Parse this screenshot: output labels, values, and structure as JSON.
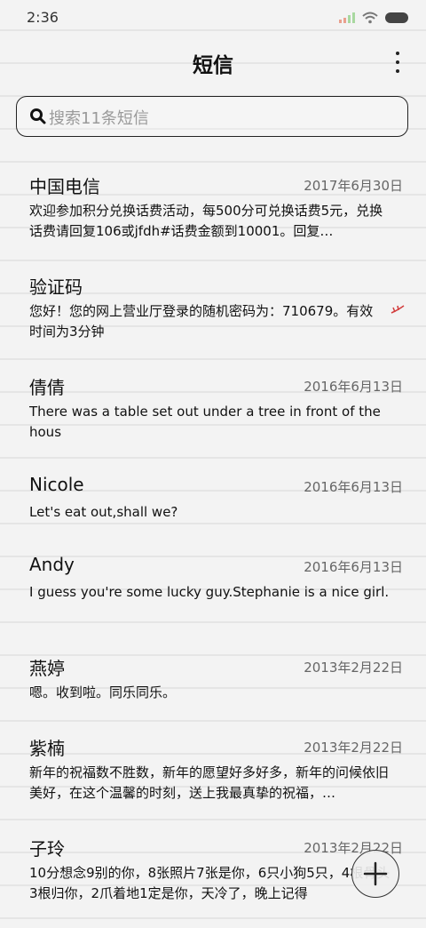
{
  "status_bar": {
    "time": "2:36",
    "signal_icon": "signal-icon",
    "wifi_icon": "wifi-icon",
    "battery_icon": "battery-icon"
  },
  "header": {
    "title": "短信",
    "more_icon": "more-vertical-icon"
  },
  "search": {
    "placeholder": "搜索11条短信",
    "icon": "search-icon"
  },
  "messages": [
    {
      "sender": "中国电信",
      "date": "2017年6月30日",
      "snippet": "欢迎参加积分兑换话费活动，每500分可兑换话费5元，兑换话费请回复106或jfdh#话费金额到10001。回复…"
    },
    {
      "sender": "验证码",
      "date": "",
      "snippet": "您好！您的网上营业厅登录的随机密码为：710679。有效时间为3分钟",
      "flag_icon": "red-flag-icon"
    },
    {
      "sender": "倩倩",
      "date": "2016年6月13日",
      "snippet": "There was a table set out under a tree in front of the hous"
    },
    {
      "sender": "Nicole",
      "date": "2016年6月13日",
      "snippet": "Let's eat out,shall we?"
    },
    {
      "sender": "Andy",
      "date": "2016年6月13日",
      "snippet": "I guess you're some lucky guy.Stephanie is a nice girl."
    },
    {
      "sender": "燕婷",
      "date": "2013年2月22日",
      "snippet": "嗯。收到啦。同乐同乐。"
    },
    {
      "sender": "紫楠",
      "date": "2013年2月22日",
      "snippet": "新年的祝福数不胜数，新年的愿望好多好多，新年的问候依旧美好，在这个温馨的时刻，送上我最真挚的祝福，…"
    },
    {
      "sender": "子玲",
      "date": "2013年2月22日",
      "snippet": "10分想念9别的你，8张照片7张是你，6只小狗5只，4根骨头3根归你，2爪着地1定是你，天冷了，晚上记得"
    }
  ],
  "fab": {
    "icon": "plus-icon"
  },
  "colors": {
    "background": "#f3f3f3",
    "text": "#111111",
    "secondary_text": "#666666",
    "flag": "#d23c3c"
  }
}
